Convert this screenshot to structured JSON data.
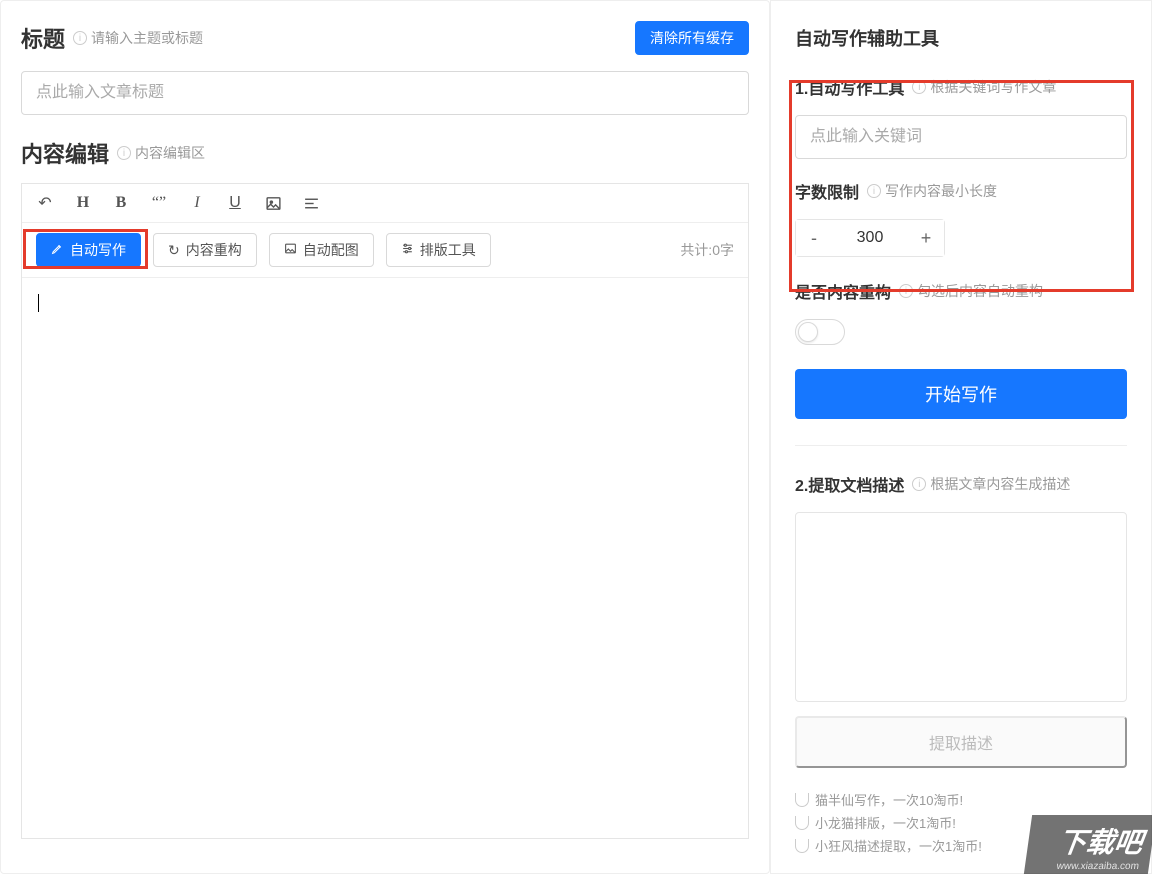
{
  "main": {
    "title_label": "标题",
    "title_hint": "请输入主题或标题",
    "clear_cache_btn": "清除所有缓存",
    "title_placeholder": "点此输入文章标题",
    "content_label": "内容编辑",
    "content_hint": "内容编辑区",
    "toolbar2": {
      "auto_write": "自动写作",
      "restructure": "内容重构",
      "auto_image": "自动配图",
      "layout_tool": "排版工具"
    },
    "counter": "共计:0字"
  },
  "side": {
    "panel_title": "自动写作辅助工具",
    "sec1_title": "1.自动写作工具",
    "sec1_hint": "根据关键词写作文章",
    "keyword_placeholder": "点此输入关键词",
    "wordlimit_label": "字数限制",
    "wordlimit_hint": "写作内容最小长度",
    "wordlimit_value": "300",
    "restructure_label": "是否内容重构",
    "restructure_hint": "勾选后内容自动重构",
    "start_btn": "开始写作",
    "sec2_title": "2.提取文档描述",
    "sec2_hint": "根据文章内容生成描述",
    "extract_btn": "提取描述",
    "costs": [
      "猫半仙写作，一次10淘币!",
      "小龙猫排版，一次1淘币!",
      "小狂风描述提取，一次1淘币!"
    ]
  },
  "watermark": {
    "big": "下载吧",
    "small": "www.xiazaiba.com"
  },
  "chart_data": null
}
